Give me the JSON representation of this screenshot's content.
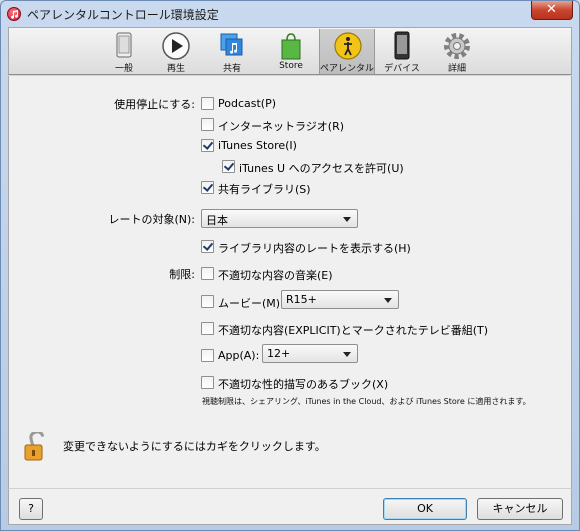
{
  "window": {
    "title": "ペアレンタルコントロール環境設定"
  },
  "toolbar": {
    "tabs": [
      {
        "label": "一般",
        "icon": "iphone-icon"
      },
      {
        "label": "再生",
        "icon": "play-icon"
      },
      {
        "label": "共有",
        "icon": "share-icon"
      },
      {
        "label": "Store",
        "icon": "store-bag-icon"
      },
      {
        "label": "ペアレンタル",
        "icon": "parental-icon"
      },
      {
        "label": "デバイス",
        "icon": "device-icon"
      },
      {
        "label": "詳細",
        "icon": "gear-icon"
      }
    ],
    "active_tab": "ペアレンタル"
  },
  "disable": {
    "label": "使用停止にする:",
    "items": [
      {
        "label": "Podcast(P)",
        "checked": false
      },
      {
        "label": "インターネットラジオ(R)",
        "checked": false
      },
      {
        "label": "iTunes Store(I)",
        "checked": true
      },
      {
        "label": "iTunes U へのアクセスを許可(U)",
        "checked": true
      },
      {
        "label": "共有ライブラリ(S)",
        "checked": true
      }
    ]
  },
  "rating": {
    "label": "レートの対象(N):",
    "country": "日本",
    "show_ratings": {
      "label": "ライブラリ内容のレートを表示する(H)",
      "checked": true
    }
  },
  "restrict": {
    "label": "制限:",
    "music": {
      "label": "不適切な内容の音楽(E)",
      "checked": false
    },
    "movies": {
      "label": "ムービー(M):",
      "checked": false,
      "value": "R15+"
    },
    "tv": {
      "label": "不適切な内容(EXPLICIT)とマークされたテレビ番組(T)",
      "checked": false
    },
    "apps": {
      "label": "App(A):",
      "checked": false,
      "value": "12+"
    },
    "books": {
      "label": "不適切な性的描写のあるブック(X)",
      "checked": false
    },
    "note": "視聴制限は、シェアリング、iTunes in the Cloud、および iTunes Store に適用されます。"
  },
  "lock": {
    "text": "変更できないようにするにはカギをクリックします。"
  },
  "footer": {
    "help": "?",
    "ok": "OK",
    "cancel": "キャンセル"
  },
  "colors": {
    "accent": "#3c7fb1",
    "titlebar": "#c9d9ee",
    "close": "#c8452f"
  }
}
